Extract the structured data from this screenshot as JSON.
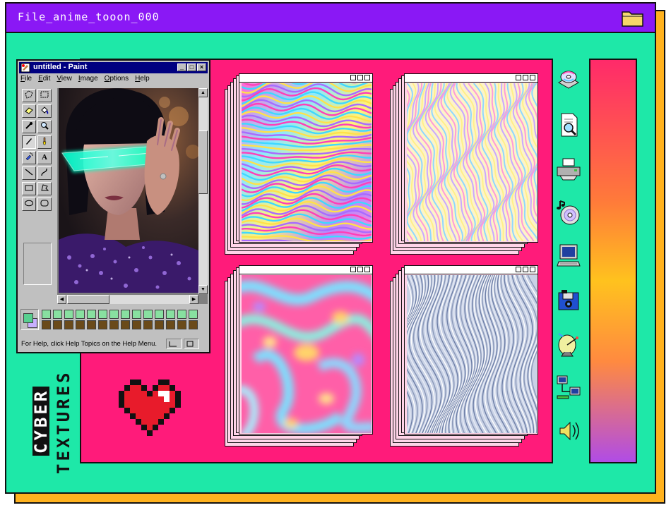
{
  "window": {
    "title": "File_anime_tooon_000"
  },
  "paint": {
    "title": "untitled - Paint",
    "menu": [
      "File",
      "Edit",
      "View",
      "Image",
      "Options",
      "Help"
    ],
    "status": "For Help, click Help Topics on the Help Menu.",
    "window_buttons": [
      "_",
      "□",
      "×"
    ],
    "tools": [
      "free-select",
      "rect-select",
      "eraser",
      "fill",
      "color-picker",
      "magnifier",
      "pencil",
      "brush",
      "airbrush",
      "text",
      "line",
      "curve",
      "rectangle",
      "polygon",
      "ellipse",
      "rounded-rectangle"
    ],
    "tool_text_glyph": "A",
    "palette_top": [
      "#88e0a0",
      "#88e0a0",
      "#88e0a0",
      "#88e0a0",
      "#88e0a0",
      "#88e0a0",
      "#88e0a0",
      "#88e0a0",
      "#88e0a0",
      "#88e0a0",
      "#88e0a0",
      "#88e0a0",
      "#88e0a0",
      "#88e0a0"
    ],
    "palette_bottom": [
      "#6a4a1a",
      "#6a4a1a",
      "#6a4a1a",
      "#6a4a1a",
      "#6a4a1a",
      "#6a4a1a",
      "#6a4a1a",
      "#6a4a1a",
      "#6a4a1a",
      "#6a4a1a",
      "#6a4a1a",
      "#6a4a1a",
      "#6a4a1a",
      "#6a4a1a"
    ]
  },
  "textures": [
    {
      "name": "holographic-waves"
    },
    {
      "name": "pastel-marble"
    },
    {
      "name": "liquid-pink-blue"
    },
    {
      "name": "silver-silk"
    }
  ],
  "side_icons": [
    "cd-install-icon",
    "search-document-icon",
    "printer-icon",
    "music-cd-icon",
    "computer-icon",
    "camera-disk-icon",
    "satellite-dish-icon",
    "network-icon",
    "speaker-icon"
  ],
  "label": {
    "line1": "CYBER",
    "line2": "TEXTURES"
  },
  "colors": {
    "background": "#1ee8a8",
    "titlebar": "#8a18f5",
    "panel": "#ff1b7a",
    "shadow": "#ffb21e",
    "heart": "#e81b2b"
  }
}
